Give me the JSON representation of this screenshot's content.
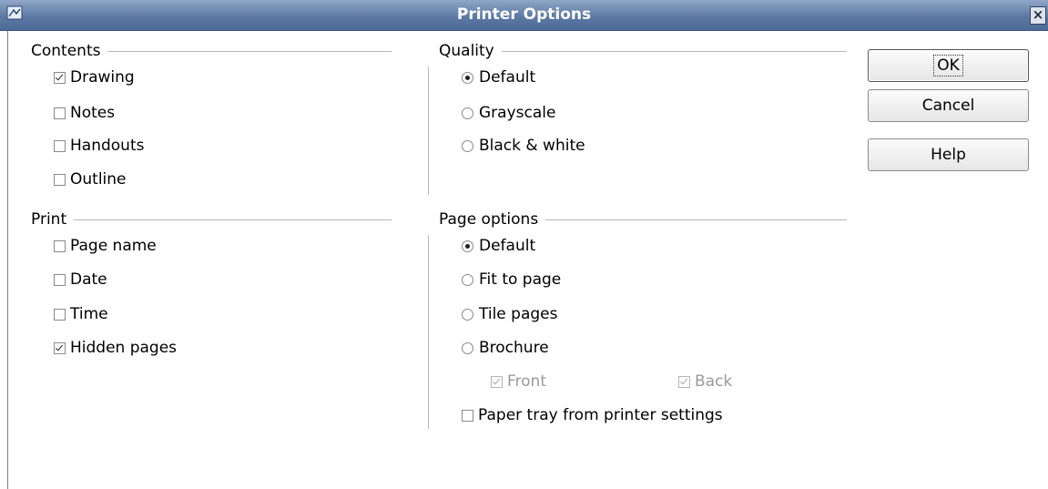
{
  "window": {
    "title": "Printer Options",
    "close_glyph": "×"
  },
  "contents": {
    "heading": "Contents",
    "items": [
      {
        "label": "Drawing",
        "checked": true
      },
      {
        "label": "Notes",
        "checked": false
      },
      {
        "label": "Handouts",
        "checked": false
      },
      {
        "label": "Outline",
        "checked": false
      }
    ]
  },
  "quality": {
    "heading": "Quality",
    "options": [
      {
        "label": "Default",
        "selected": true
      },
      {
        "label": "Grayscale",
        "selected": false
      },
      {
        "label": "Black & white",
        "selected": false
      }
    ]
  },
  "print": {
    "heading": "Print",
    "items": [
      {
        "label": "Page name",
        "checked": false
      },
      {
        "label": "Date",
        "checked": false
      },
      {
        "label": "Time",
        "checked": false
      },
      {
        "label": "Hidden pages",
        "checked": true
      }
    ]
  },
  "page_options": {
    "heading": "Page options",
    "options": [
      {
        "label": "Default",
        "selected": true
      },
      {
        "label": "Fit to page",
        "selected": false
      },
      {
        "label": "Tile pages",
        "selected": false
      },
      {
        "label": "Brochure",
        "selected": false
      }
    ],
    "brochure_front": {
      "label": "Front",
      "checked": true,
      "enabled": false
    },
    "brochure_back": {
      "label": "Back",
      "checked": true,
      "enabled": false
    },
    "paper_tray": {
      "label": "Paper tray from printer settings",
      "checked": false
    }
  },
  "buttons": {
    "ok": "OK",
    "cancel": "Cancel",
    "help": "Help"
  },
  "colors": {
    "titlebar": "#5d7aa5",
    "titlebar_text": "#ffffff",
    "separator": "#b8b8b8",
    "disabled_text": "#9a9a9a"
  }
}
